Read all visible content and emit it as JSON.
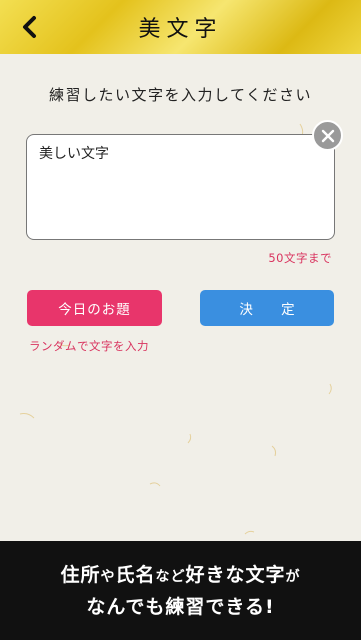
{
  "header": {
    "title": "美文字",
    "back_icon": "chevron-left-icon"
  },
  "form": {
    "prompt": "練習したい文字を入力してください",
    "input_value": "美しい文字",
    "char_limit": "50文字まで",
    "clear_icon": "close-icon"
  },
  "actions": {
    "today_label": "今日のお題",
    "decide_label": "決 定",
    "random_label": "ランダムで文字を入力"
  },
  "footer": {
    "line1": [
      {
        "text": "住所",
        "size": "big"
      },
      {
        "text": "や",
        "size": "small"
      },
      {
        "text": "氏名",
        "size": "big"
      },
      {
        "text": "など",
        "size": "small"
      },
      {
        "text": "好きな文字",
        "size": "big"
      },
      {
        "text": "が",
        "size": "small"
      }
    ],
    "line2": "なんでも練習できる!"
  },
  "colors": {
    "header_gold": "#e4c21c",
    "accent_pink": "#e8356b",
    "accent_blue": "#3a8fe0",
    "note_red": "#d9345f",
    "footer_bg": "#111111"
  }
}
